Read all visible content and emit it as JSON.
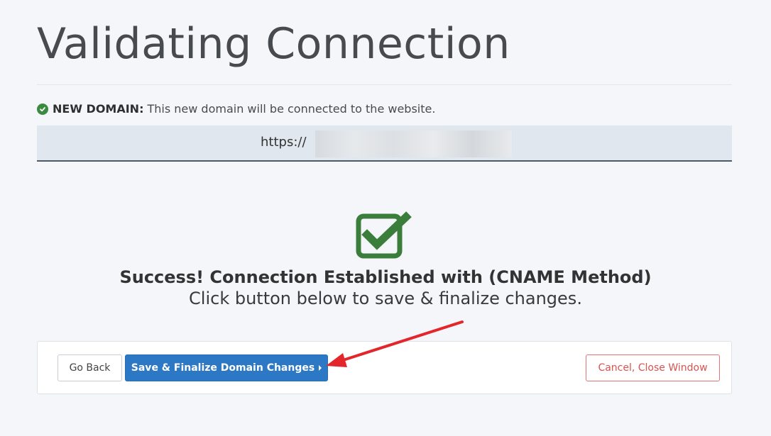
{
  "page": {
    "title": "Validating Connection"
  },
  "notice": {
    "label": "NEW DOMAIN:",
    "text": "This new domain will be connected to the website.",
    "icon": "check-circle-icon"
  },
  "domain": {
    "prefix": "https://",
    "value_redacted": true
  },
  "status": {
    "icon": "check-square-icon",
    "headline": "Success! Connection Established with (CNAME Method)",
    "subline": "Click button below to save & finalize changes."
  },
  "actions": {
    "go_back_label": "Go Back",
    "save_label": "Save & Finalize Domain Changes",
    "cancel_label": "Cancel, Close Window"
  },
  "colors": {
    "success_green": "#3b7d3b",
    "primary_blue": "#2d78c4",
    "cancel_red": "#d9534f",
    "annotation_arrow": "#e3262b"
  }
}
